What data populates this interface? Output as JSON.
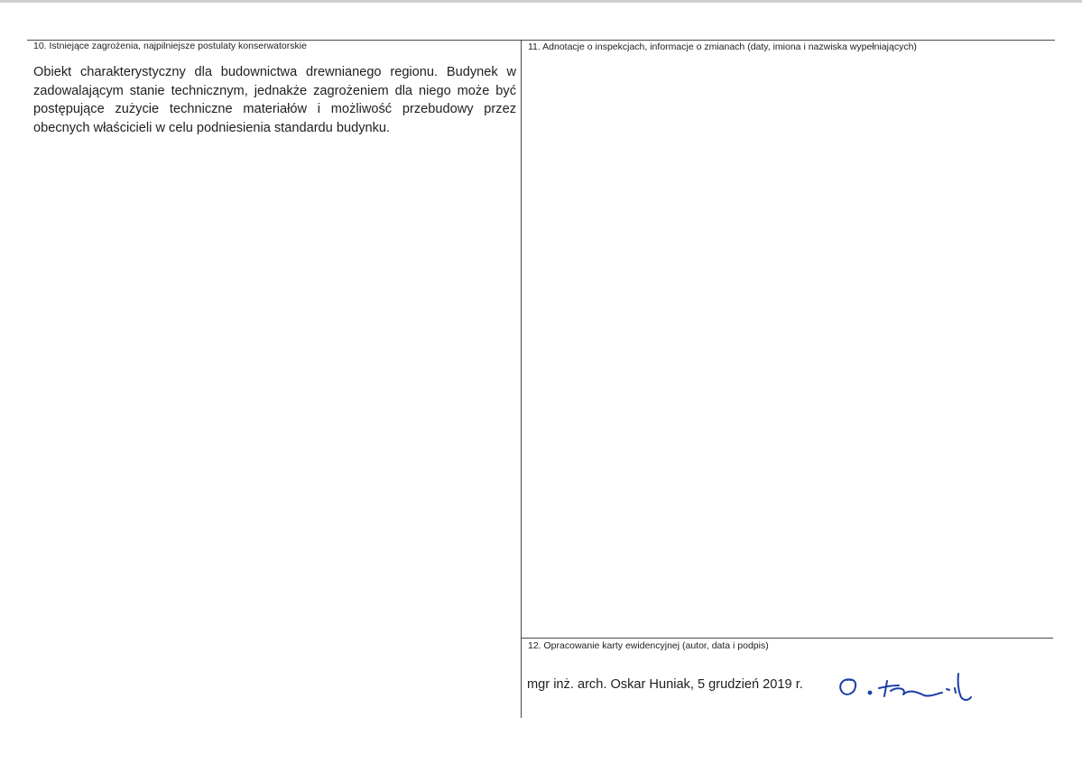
{
  "sections": {
    "threats": {
      "heading": "10. Istniejące zagrożenia, najpilniejsze postulaty konserwatorskie",
      "text": "Obiekt charakterystyczny dla budownictwa drewnianego regionu. Budynek w zadowalającym stanie technicznym, jednakże zagrożeniem dla niego może być postępujące zużycie techniczne materiałów i możliwość przebudowy przez obecnych właścicieli w celu podniesienia standardu budynku."
    },
    "inspections": {
      "heading": "11. Adnotacje o inspekcjach, informacje o zmianach (daty, imiona i nazwiska wypełniających)"
    },
    "record_card": {
      "heading": "12. Opracowanie karty ewidencyjnej (autor, data i podpis)",
      "author_line": "mgr inż. arch. Oskar Huniak, 5 grudzień 2019 r.",
      "signature": "O. Huniak"
    }
  },
  "colors": {
    "rule": "#4a4a4a",
    "text": "#1e1e1e",
    "signature_ink": "#1a3fa8"
  }
}
